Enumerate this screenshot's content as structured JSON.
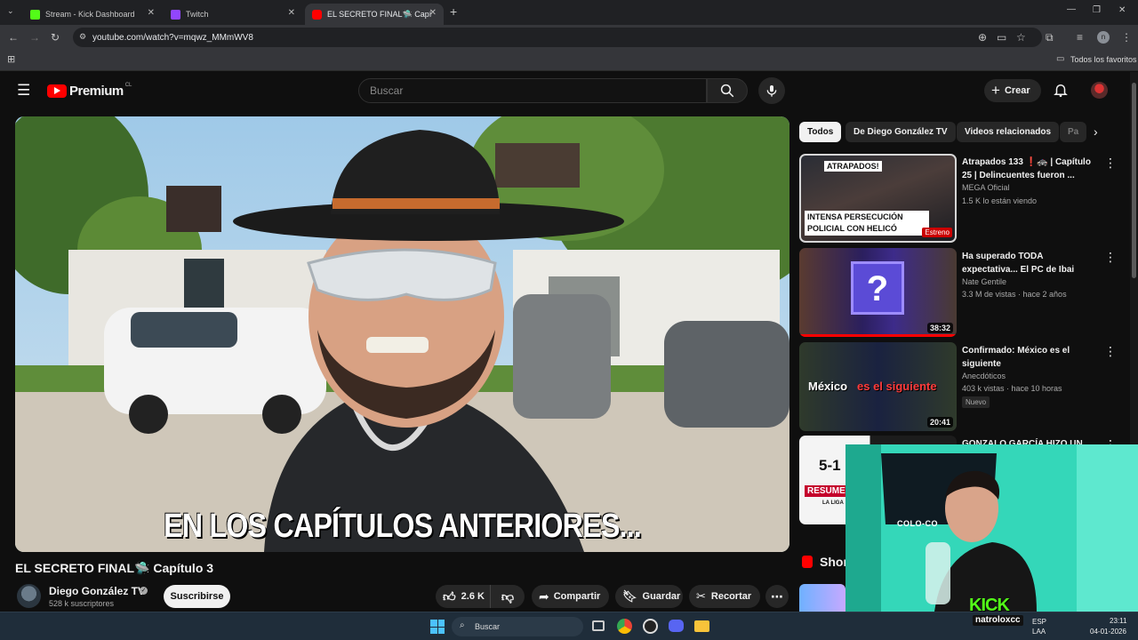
{
  "browser": {
    "tabs": [
      {
        "label": "Stream - Kick Dashboard",
        "favicon_color": "#53fc18"
      },
      {
        "label": "Twitch",
        "favicon_color": "#9146ff"
      },
      {
        "label": "EL SECRETO FINAL🛸 Capítulo",
        "favicon_color": "#ff0000"
      }
    ],
    "new_tab": "+",
    "url": "youtube.com/watch?v=mqwz_MMmWV8",
    "bookmarks_folder": "Todos los favoritos",
    "profile_initial": "n"
  },
  "youtube": {
    "logo_text": "Premium",
    "logo_region": "CL",
    "search_placeholder": "Buscar",
    "create_label": "Crear"
  },
  "video": {
    "subtitle": "EN LOS CAPÍTULOS ANTERIORES...",
    "title": "EL SECRETO FINAL🛸 Capítulo 3",
    "channel": "Diego González TV",
    "subscribers": "528 k suscriptores",
    "subscribe_label": "Suscribirse",
    "likes": "2.6 K",
    "share_label": "Compartir",
    "save_label": "Guardar",
    "clip_label": "Recortar"
  },
  "sidebar": {
    "chips": [
      "Todos",
      "De Diego González TV",
      "Videos relacionados",
      "Pa"
    ],
    "recommendations": [
      {
        "title": "Atrapados 133 ❗🚓 | Capítulo 25 | Delincuentes fueron ...",
        "channel": "MEGA Oficial",
        "meta": "1.5 K lo están viendo",
        "badge": "Estreno",
        "thumb_top": "ATRAPADOS!",
        "thumb_bottom": "INTENSA PERSECUCIÓN POLICIAL CON HELICÓ"
      },
      {
        "title": "Ha superado TODA expectativa... El PC de Ibai",
        "channel": "Nate Gentile",
        "meta": "3.3 M de vistas · hace 2 años",
        "duration": "38:32"
      },
      {
        "title": "Confirmado: México es el siguiente",
        "channel": "Anecdóticos",
        "meta": "403 k vistas · hace 10 horas",
        "badge": "Nuevo",
        "duration": "20:41",
        "thumb_text_a": "México",
        "thumb_text_b": "es el siguiente"
      },
      {
        "title": "GONZALO GARCÍA HIZO UN",
        "thumb_score": "5-1",
        "thumb_label": "RESUME",
        "thumb_sub": "LA LIGA"
      }
    ],
    "shorts_label": "Shor"
  },
  "webcam": {
    "brand": "KICK",
    "handle": "natroloxcc",
    "flag_text": "COLO-CO"
  },
  "taskbar": {
    "search_label": "Buscar",
    "lang": "ESP",
    "lang_sub": "LAA",
    "time": "23:11",
    "date": "04-01-2026"
  },
  "colors": {
    "youtube_red": "#ff0000",
    "kick_green": "#53fc18",
    "background": "#0f0f0f"
  }
}
